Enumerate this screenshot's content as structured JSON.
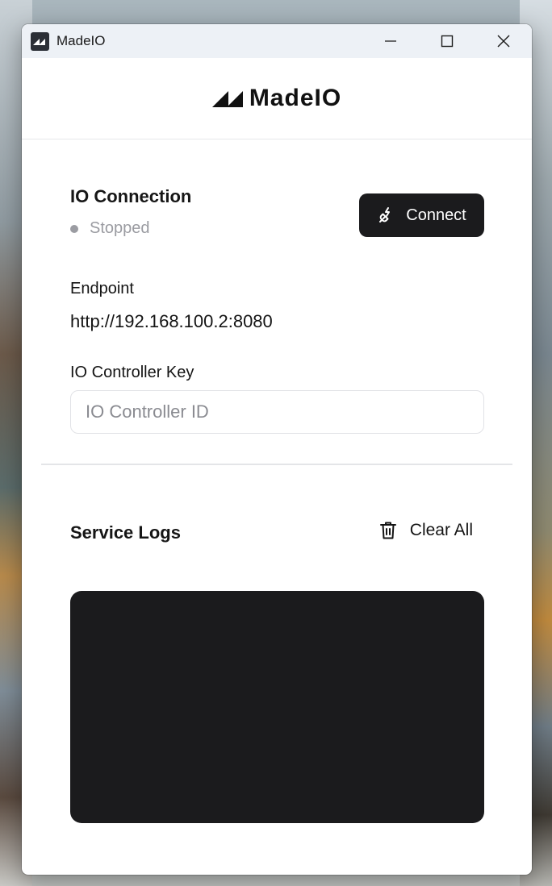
{
  "window": {
    "title": "MadeIO"
  },
  "header": {
    "logo_text": "MadeIO"
  },
  "connection": {
    "title": "IO Connection",
    "status": "Stopped",
    "status_color": "#9b9ca2",
    "connect_label": "Connect",
    "connect_icon": "plug-icon"
  },
  "endpoint": {
    "label": "Endpoint",
    "value": "http://192.168.100.2:8080"
  },
  "controller_key": {
    "label": "IO Controller Key",
    "value": "",
    "placeholder": "IO Controller ID"
  },
  "logs": {
    "title": "Service Logs",
    "clear_label": "Clear All",
    "clear_icon": "trash-icon",
    "entries": []
  },
  "colors": {
    "accent_dark": "#1b1b1d",
    "titlebar": "#edf1f6"
  }
}
